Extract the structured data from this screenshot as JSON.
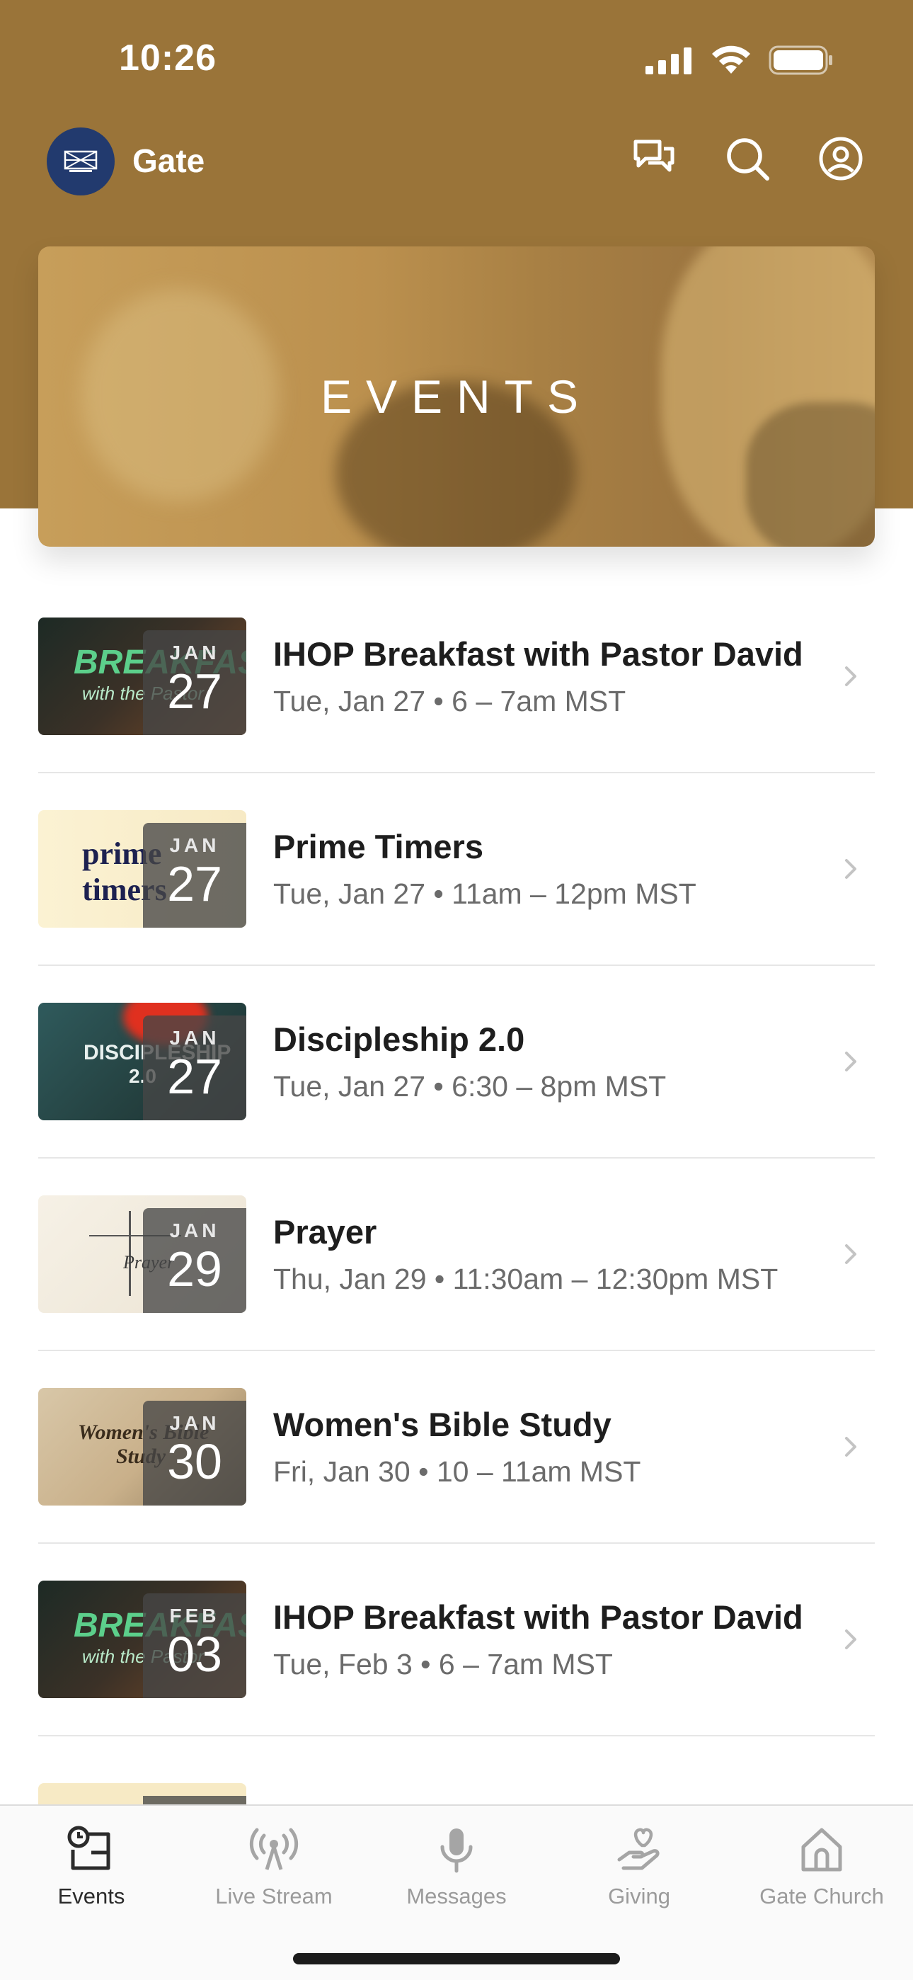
{
  "status_bar": {
    "time": "10:26"
  },
  "header": {
    "app_name": "Gate"
  },
  "banner": {
    "title": "EVENTS"
  },
  "events": [
    {
      "title": "IHOP Breakfast with Pastor David",
      "subtitle": "Tue, Jan 27 • 6 – 7am MST",
      "month": "JAN",
      "day": "27",
      "thumb_text": "BREAKFAST",
      "thumb_sub": "with the Pastor"
    },
    {
      "title": "Prime Timers",
      "subtitle": "Tue, Jan 27 • 11am – 12pm MST",
      "month": "JAN",
      "day": "27",
      "thumb_text": "prime timers",
      "thumb_sub": ""
    },
    {
      "title": "Discipleship 2.0",
      "subtitle": "Tue, Jan 27 • 6:30 – 8pm MST",
      "month": "JAN",
      "day": "27",
      "thumb_text": "DISCIPLESHIP",
      "thumb_sub": "2.0"
    },
    {
      "title": "Prayer",
      "subtitle": "Thu, Jan 29 • 11:30am – 12:30pm MST",
      "month": "JAN",
      "day": "29",
      "thumb_text": "Prayer",
      "thumb_sub": ""
    },
    {
      "title": "Women's Bible Study",
      "subtitle": "Fri, Jan 30 • 10 – 11am MST",
      "month": "JAN",
      "day": "30",
      "thumb_text": "Women's Bible",
      "thumb_sub": "Study"
    },
    {
      "title": "IHOP Breakfast with Pastor David",
      "subtitle": "Tue, Feb 3 • 6 – 7am MST",
      "month": "FEB",
      "day": "03",
      "thumb_text": "BREAKFAST",
      "thumb_sub": "with the Pastor"
    }
  ],
  "tabs": [
    {
      "label": "Events",
      "icon": "calendar-clock-icon",
      "active": true
    },
    {
      "label": "Live Stream",
      "icon": "broadcast-icon",
      "active": false
    },
    {
      "label": "Messages",
      "icon": "microphone-icon",
      "active": false
    },
    {
      "label": "Giving",
      "icon": "heart-hand-icon",
      "active": false
    },
    {
      "label": "Gate Church",
      "icon": "house-icon",
      "active": false
    }
  ],
  "colors": {
    "header_bg": "#9a7439",
    "logo_bg": "#223a6e"
  }
}
